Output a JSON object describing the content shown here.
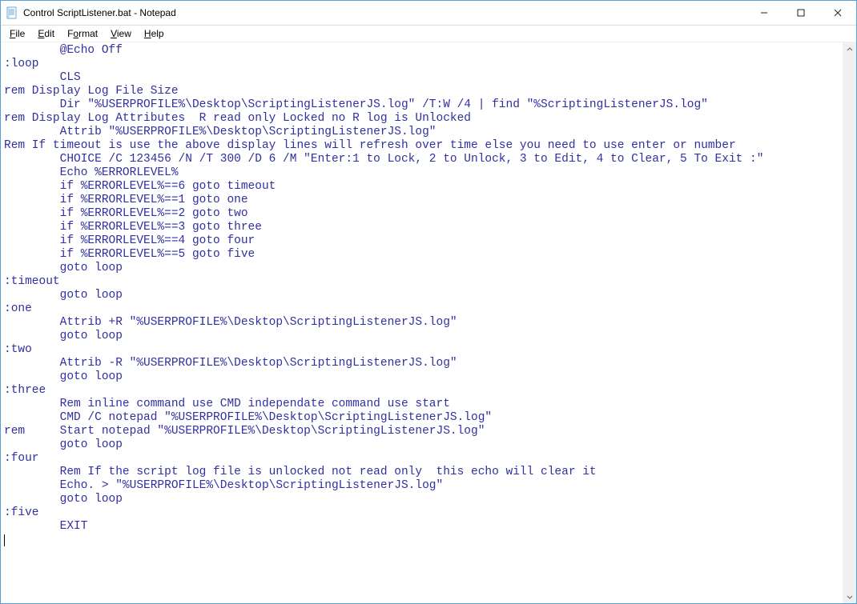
{
  "window": {
    "title": "Control ScriptListener.bat - Notepad"
  },
  "menu": {
    "file": {
      "label": "File",
      "accel": "F"
    },
    "edit": {
      "label": "Edit",
      "accel": "E"
    },
    "format": {
      "label": "Format",
      "accel": "o"
    },
    "view": {
      "label": "View",
      "accel": "V"
    },
    "help": {
      "label": "Help",
      "accel": "H"
    }
  },
  "icons": {
    "minimize": "minimize-icon",
    "maximize": "maximize-icon",
    "close": "close-icon",
    "app": "notepad-icon",
    "up": "scroll-up-icon",
    "down": "scroll-down-icon"
  },
  "editor": {
    "text": "        @Echo Off\n:loop\n        CLS\nrem Display Log File Size\n        Dir \"%USERPROFILE%\\Desktop\\ScriptingListenerJS.log\" /T:W /4 | find \"%ScriptingListenerJS.log\"\nrem Display Log Attributes  R read only Locked no R log is Unlocked\n        Attrib \"%USERPROFILE%\\Desktop\\ScriptingListenerJS.log\"\nRem If timeout is use the above display lines will refresh over time else you need to use enter or number\n        CHOICE /C 123456 /N /T 300 /D 6 /M \"Enter:1 to Lock, 2 to Unlock, 3 to Edit, 4 to Clear, 5 To Exit :\"\n        Echo %ERRORLEVEL%\n        if %ERRORLEVEL%==6 goto timeout\n        if %ERRORLEVEL%==1 goto one\n        if %ERRORLEVEL%==2 goto two\n        if %ERRORLEVEL%==3 goto three\n        if %ERRORLEVEL%==4 goto four\n        if %ERRORLEVEL%==5 goto five\n        goto loop\n:timeout\n        goto loop\n:one\n        Attrib +R \"%USERPROFILE%\\Desktop\\ScriptingListenerJS.log\"\n        goto loop\n:two\n        Attrib -R \"%USERPROFILE%\\Desktop\\ScriptingListenerJS.log\"\n        goto loop\n:three\n        Rem inline command use CMD independate command use start\n        CMD /C notepad \"%USERPROFILE%\\Desktop\\ScriptingListenerJS.log\"\nrem     Start notepad \"%USERPROFILE%\\Desktop\\ScriptingListenerJS.log\"\n        goto loop\n:four\n        Rem If the script log file is unlocked not read only  this echo will clear it\n        Echo. > \"%USERPROFILE%\\Desktop\\ScriptingListenerJS.log\"\n        goto loop\n:five\n        EXIT\n"
  }
}
